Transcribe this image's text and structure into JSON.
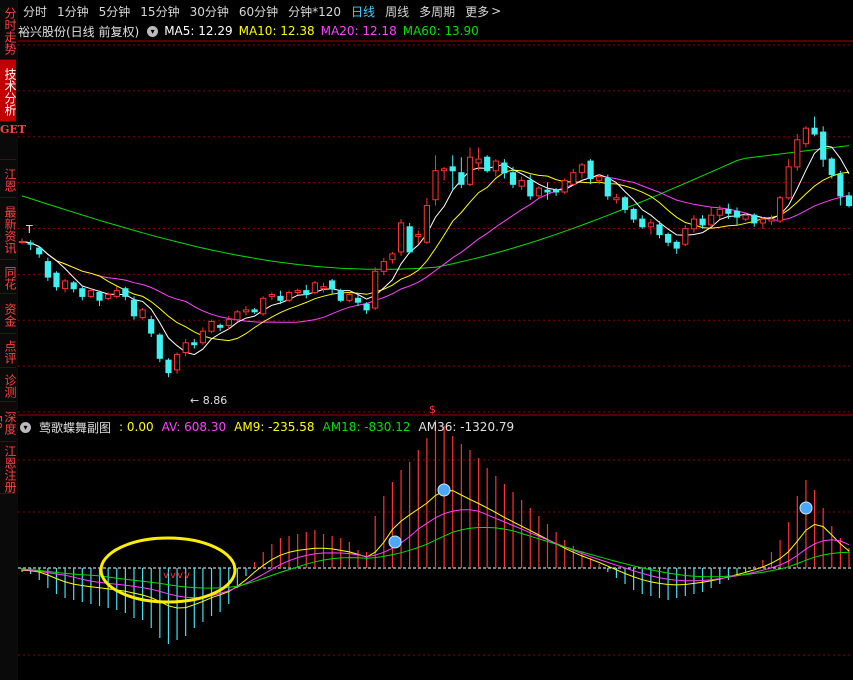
{
  "sidebar": [
    {
      "label": "分时走势",
      "active": false
    },
    {
      "label": "技术分析",
      "active": true
    },
    {
      "label": "GET",
      "active": false
    },
    {
      "label": "江恩",
      "active": false
    },
    {
      "label": "最新资讯",
      "active": false
    },
    {
      "label": "同花",
      "active": false
    },
    {
      "label": "资金",
      "active": false
    },
    {
      "label": "点评",
      "active": false
    },
    {
      "label": "诊测",
      "active": false
    },
    {
      "label": "深度F9",
      "active": false
    },
    {
      "label": "江恩注册",
      "active": false
    }
  ],
  "toolbar": {
    "items": [
      "分时",
      "1分钟",
      "5分钟",
      "15分钟",
      "30分钟",
      "60分钟",
      "分钟*120",
      "日线",
      "周线",
      "多周期",
      "更多"
    ],
    "active": "日线"
  },
  "header": {
    "stock_name": "裕兴股份(日线 前复权)",
    "ma5": "MA5: 12.29",
    "ma10": "MA10: 12.38",
    "ma20": "MA20: 12.18",
    "ma60": "MA60: 13.90"
  },
  "main_chart": {
    "low_label": "8.86",
    "dollar_mark": "$"
  },
  "indicator": {
    "name": "莺歌蝶舞副图",
    "v0": ": 0.00",
    "av": "AV: 608.30",
    "am9": "AM9: -235.58",
    "am18": "AM18: -830.12",
    "am36": "AM36: -1320.79"
  },
  "colors": {
    "ma5": "#ffffff",
    "ma10": "#ffff00",
    "ma20": "#ff40ff",
    "ma60": "#00e000",
    "up": "#ff3030",
    "down": "#40f0f0",
    "grid": "#8a0000"
  },
  "chart_data": {
    "type": "candlestick",
    "candles": [
      [
        12.35,
        12.37,
        12.3,
        12.45
      ],
      [
        12.33,
        12.3,
        12.15,
        12.4
      ],
      [
        12.2,
        12.05,
        11.95,
        12.25
      ],
      [
        11.85,
        11.45,
        11.35,
        11.95
      ],
      [
        11.55,
        11.2,
        11.1,
        11.6
      ],
      [
        11.15,
        11.35,
        11.05,
        11.4
      ],
      [
        11.3,
        11.15,
        11.05,
        11.35
      ],
      [
        11.15,
        10.95,
        10.85,
        11.2
      ],
      [
        10.95,
        11.1,
        10.9,
        11.15
      ],
      [
        11.05,
        10.85,
        10.7,
        11.1
      ],
      [
        10.9,
        11.0,
        10.85,
        11.05
      ],
      [
        10.95,
        11.1,
        10.9,
        11.2
      ],
      [
        11.15,
        10.95,
        10.85,
        11.2
      ],
      [
        10.85,
        10.45,
        10.35,
        10.95
      ],
      [
        10.4,
        10.6,
        10.35,
        10.65
      ],
      [
        10.35,
        10.0,
        9.9,
        10.45
      ],
      [
        9.95,
        9.35,
        9.25,
        10.0
      ],
      [
        9.3,
        8.98,
        8.86,
        9.35
      ],
      [
        9.05,
        9.45,
        8.95,
        9.5
      ],
      [
        9.5,
        9.75,
        9.4,
        9.85
      ],
      [
        9.75,
        9.7,
        9.6,
        9.85
      ],
      [
        9.75,
        10.05,
        9.7,
        10.15
      ],
      [
        10.05,
        10.3,
        10.0,
        10.35
      ],
      [
        10.2,
        10.15,
        10.05,
        10.25
      ],
      [
        10.2,
        10.35,
        10.1,
        10.45
      ],
      [
        10.35,
        10.55,
        10.3,
        10.6
      ],
      [
        10.55,
        10.6,
        10.45,
        10.7
      ],
      [
        10.6,
        10.55,
        10.5,
        10.65
      ],
      [
        10.5,
        10.9,
        10.45,
        10.95
      ],
      [
        10.95,
        11.0,
        10.85,
        11.05
      ],
      [
        10.95,
        10.85,
        10.75,
        11.1
      ],
      [
        10.85,
        11.05,
        10.8,
        11.1
      ],
      [
        11.05,
        11.1,
        11.0,
        11.15
      ],
      [
        11.1,
        11.0,
        10.9,
        11.25
      ],
      [
        11.05,
        11.3,
        11.0,
        11.35
      ],
      [
        11.15,
        11.2,
        11.05,
        11.3
      ],
      [
        11.35,
        11.15,
        11.0,
        11.4
      ],
      [
        11.1,
        10.85,
        10.8,
        11.15
      ],
      [
        10.85,
        11.0,
        10.8,
        11.05
      ],
      [
        10.9,
        10.8,
        10.7,
        11.0
      ],
      [
        10.75,
        10.6,
        10.5,
        10.8
      ],
      [
        10.65,
        11.6,
        10.6,
        11.7
      ],
      [
        11.6,
        11.85,
        11.5,
        11.95
      ],
      [
        11.9,
        12.05,
        11.8,
        12.1
      ],
      [
        12.1,
        12.85,
        12.0,
        12.95
      ],
      [
        12.75,
        12.1,
        12.05,
        12.85
      ],
      [
        12.5,
        12.55,
        12.3,
        12.65
      ],
      [
        12.35,
        13.3,
        12.3,
        13.5
      ],
      [
        13.45,
        14.2,
        13.3,
        14.6
      ],
      [
        14.2,
        14.25,
        13.95,
        14.3
      ],
      [
        14.3,
        14.2,
        13.7,
        14.6
      ],
      [
        14.15,
        13.85,
        13.75,
        14.55
      ],
      [
        13.85,
        14.55,
        13.8,
        14.8
      ],
      [
        14.4,
        14.5,
        14.2,
        14.8
      ],
      [
        14.55,
        14.2,
        14.15,
        14.6
      ],
      [
        14.2,
        14.45,
        14.05,
        14.5
      ],
      [
        14.4,
        14.15,
        14.0,
        14.5
      ],
      [
        14.15,
        13.85,
        13.75,
        14.3
      ],
      [
        13.8,
        13.95,
        13.7,
        14.05
      ],
      [
        13.95,
        13.55,
        13.45,
        14.1
      ],
      [
        13.55,
        13.75,
        13.5,
        13.8
      ],
      [
        13.7,
        13.65,
        13.45,
        13.9
      ],
      [
        13.7,
        13.65,
        13.55,
        13.75
      ],
      [
        13.65,
        13.95,
        13.6,
        14.0
      ],
      [
        13.85,
        14.15,
        13.8,
        14.25
      ],
      [
        14.15,
        14.35,
        14.0,
        14.4
      ],
      [
        14.45,
        14.0,
        13.85,
        14.5
      ],
      [
        13.95,
        14.05,
        13.85,
        14.1
      ],
      [
        14.0,
        13.55,
        13.45,
        14.1
      ],
      [
        13.45,
        13.5,
        13.35,
        13.6
      ],
      [
        13.5,
        13.2,
        13.1,
        13.55
      ],
      [
        13.2,
        12.95,
        12.85,
        13.25
      ],
      [
        12.95,
        12.75,
        12.7,
        13.05
      ],
      [
        12.75,
        12.85,
        12.55,
        12.95
      ],
      [
        12.8,
        12.55,
        12.45,
        12.9
      ],
      [
        12.55,
        12.35,
        12.25,
        12.6
      ],
      [
        12.35,
        12.2,
        12.05,
        12.4
      ],
      [
        12.3,
        12.7,
        12.25,
        12.8
      ],
      [
        12.7,
        12.95,
        12.6,
        13.05
      ],
      [
        12.95,
        12.8,
        12.7,
        13.05
      ],
      [
        12.8,
        13.05,
        12.75,
        13.25
      ],
      [
        13.05,
        13.2,
        12.95,
        13.3
      ],
      [
        13.2,
        13.1,
        12.95,
        13.35
      ],
      [
        13.15,
        13.0,
        12.8,
        13.25
      ],
      [
        12.95,
        13.05,
        12.9,
        13.1
      ],
      [
        13.05,
        12.85,
        12.75,
        13.1
      ],
      [
        12.85,
        12.95,
        12.7,
        13.0
      ],
      [
        12.9,
        12.95,
        12.8,
        13.05
      ],
      [
        12.9,
        13.5,
        12.85,
        13.55
      ],
      [
        13.5,
        14.3,
        13.45,
        14.5
      ],
      [
        14.3,
        15.0,
        14.2,
        15.15
      ],
      [
        14.9,
        15.3,
        14.8,
        15.35
      ],
      [
        15.3,
        15.15,
        15.1,
        15.6
      ],
      [
        15.2,
        14.5,
        14.3,
        15.35
      ],
      [
        14.5,
        14.1,
        14.0,
        14.55
      ],
      [
        14.1,
        13.55,
        13.3,
        14.2
      ],
      [
        13.55,
        13.3,
        13.25,
        13.65
      ]
    ],
    "price_range": [
      8.86,
      15.6
    ],
    "ma5_color": "#ffffff",
    "ma10_color": "#ffff00",
    "ma20_color": "#ff40ff",
    "ma60_color": "#00e000",
    "indicator": {
      "bars": [
        -40,
        -60,
        -120,
        -200,
        -260,
        -300,
        -320,
        -340,
        -360,
        -380,
        -400,
        -420,
        -450,
        -500,
        -520,
        -600,
        -700,
        -760,
        -720,
        -680,
        -600,
        -540,
        -480,
        -440,
        -360,
        -200,
        -80,
        60,
        160,
        240,
        300,
        320,
        340,
        360,
        380,
        340,
        320,
        300,
        260,
        180,
        160,
        520,
        720,
        860,
        980,
        1060,
        1180,
        1300,
        1480,
        1420,
        1320,
        1240,
        1180,
        1100,
        1000,
        920,
        840,
        760,
        680,
        600,
        520,
        440,
        360,
        280,
        220,
        160,
        100,
        40,
        -40,
        -100,
        -160,
        -220,
        -260,
        -280,
        -300,
        -320,
        -300,
        -280,
        -260,
        -240,
        -200,
        -160,
        -120,
        -80,
        -40,
        20,
        80,
        160,
        280,
        460,
        720,
        880,
        780,
        600,
        420,
        300,
        200
      ],
      "av_last": 608.3,
      "am9_last": -235.58,
      "am18_last": -830.12,
      "am36_last": -1320.79
    }
  }
}
